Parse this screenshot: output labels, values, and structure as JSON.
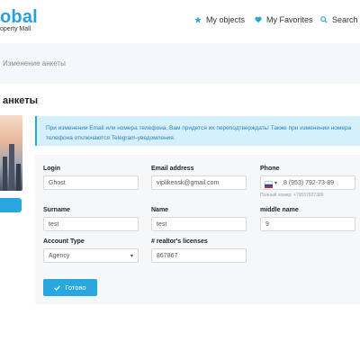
{
  "header": {
    "logo_text": "obal",
    "logo_sub": "operty Mall",
    "nav": [
      {
        "label": "My objects",
        "icon": "star-icon"
      },
      {
        "label": "My Favorites",
        "icon": "heart-icon"
      },
      {
        "label": "Search",
        "icon": "search-icon"
      }
    ]
  },
  "breadcrumb": "Изменение анкеты",
  "page_title": "анкеты",
  "alert": "При изменении Email или номера телефона, Вам придется их переподтверждать! Также при изменении номера телефона отключаются Telegram-уведомления.",
  "form": {
    "login": {
      "label": "Login",
      "value": "Ghost"
    },
    "email": {
      "label": "Email address",
      "value": "viplikensk@gmail.com"
    },
    "phone": {
      "label": "Phone",
      "value": "8 (953) 792-73-89",
      "hint": "Полный номер: +79537927389"
    },
    "surname": {
      "label": "Surname",
      "value": "test"
    },
    "name": {
      "label": "Name",
      "value": "test"
    },
    "middle_name": {
      "label": "middle name",
      "value": "9"
    },
    "account_type": {
      "label": "Account Type",
      "value": "Agency"
    },
    "licenses": {
      "label": "# realtor's licenses",
      "value": "867867"
    },
    "submit_label": "Готово"
  },
  "colors": {
    "accent": "#29a8e0",
    "alert_bg": "#d6f0fb",
    "alert_text": "#2a7fb4"
  }
}
